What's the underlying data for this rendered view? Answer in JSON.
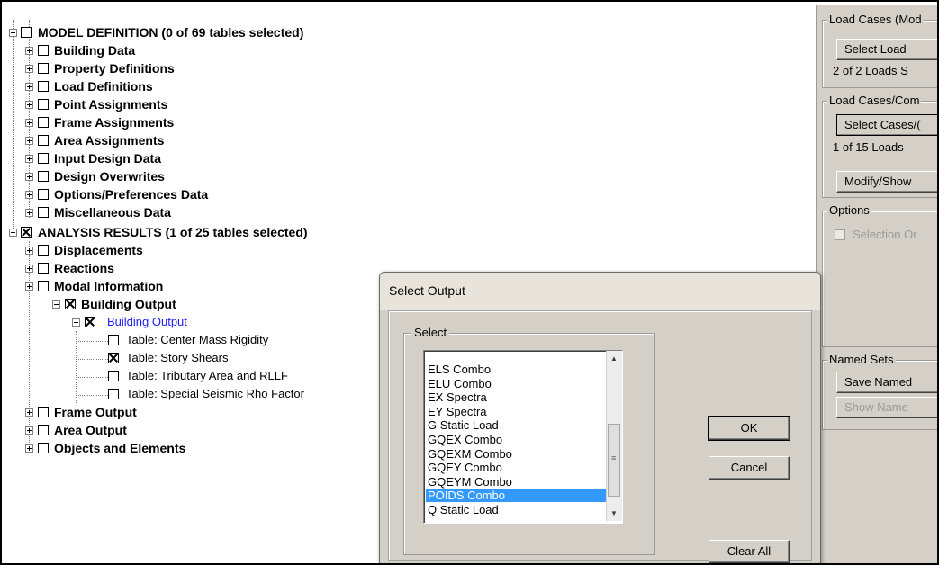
{
  "tree": {
    "model_definition": {
      "label": "MODEL DEFINITION  (0 of 69 tables selected)"
    },
    "model_children": [
      "Building Data",
      "Property Definitions",
      "Load Definitions",
      "Point Assignments",
      "Frame Assignments",
      "Area Assignments",
      "Input Design Data",
      "Design Overwrites",
      "Options/Preferences Data",
      "Miscellaneous Data"
    ],
    "analysis_results": {
      "label": "ANALYSIS RESULTS  (1 of 25 tables selected)"
    },
    "analysis_children_top": [
      "Displacements",
      "Reactions",
      "Modal Information"
    ],
    "building_output": {
      "label": "Building Output",
      "sub_label": "Building Output"
    },
    "tables": [
      "Table:  Center Mass Rigidity",
      "Table:  Story Shears",
      "Table:  Tributary Area and RLLF",
      "Table:  Special Seismic Rho Factor"
    ],
    "analysis_children_bottom": [
      "Frame Output",
      "Area Output",
      "Objects and Elements"
    ]
  },
  "right_panel": {
    "load_cases_group": "Load Cases (Mod",
    "select_load_button": "Select Load",
    "loads_count": "2  of 2  Loads S",
    "load_cases_combo_group": "Load Cases/Com",
    "select_cases_button": "Select Cases/(",
    "loads_count_2": "1  of 15  Loads",
    "modify_show_button": "Modify/Show",
    "options_group": "Options",
    "selection_only": "Selection Or",
    "named_sets_group": "Named Sets",
    "save_named_button": "Save Named",
    "show_named_button": "Show Name"
  },
  "dialog": {
    "title": "Select Output",
    "select_group": "Select",
    "items": [
      "ELS Combo",
      "ELU Combo",
      "EX Spectra",
      "EY Spectra",
      "G Static Load",
      "GQEX Combo",
      "GQEXM Combo",
      "GQEY Combo",
      "GQEYM Combo",
      "POIDS Combo",
      "Q Static Load"
    ],
    "selected_item": "POIDS Combo",
    "ok_button": "OK",
    "cancel_button": "Cancel",
    "clear_all_button": "Clear All"
  }
}
